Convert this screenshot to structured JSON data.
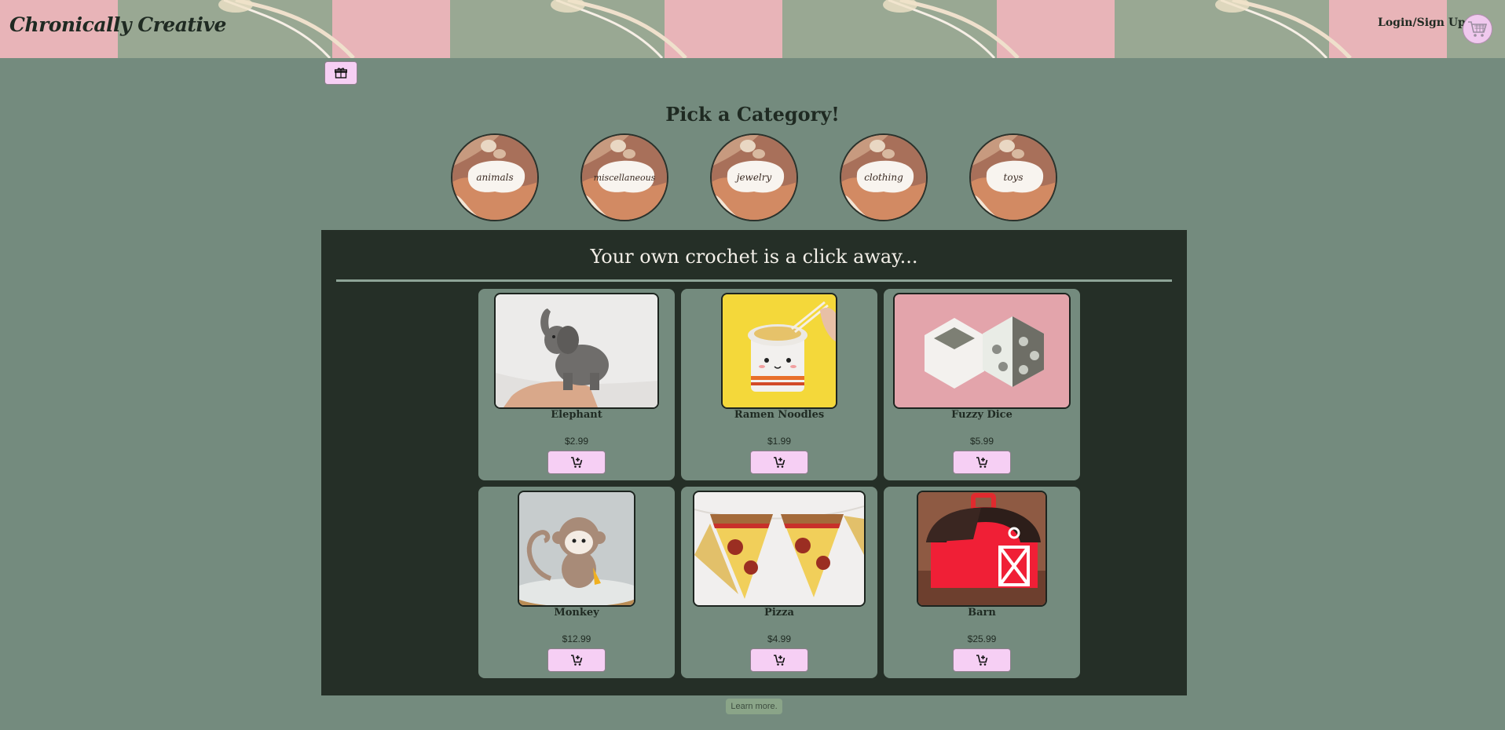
{
  "header": {
    "brand": "Chronically Creative",
    "login_label": "Login/Sign Up",
    "cart_icon": "shopping-cart-icon"
  },
  "toolbar": {
    "gift_icon": "gift-box-icon"
  },
  "categories": {
    "title": "Pick a Category!",
    "items": [
      {
        "label": "animals"
      },
      {
        "label": "miscellaneous"
      },
      {
        "label": "jewelry"
      },
      {
        "label": "clothing"
      },
      {
        "label": "toys"
      }
    ]
  },
  "products": {
    "title": "Your own crochet is a click away...",
    "items": [
      {
        "name": "Elephant",
        "price": "$2.99"
      },
      {
        "name": "Ramen Noodles",
        "price": "$1.99"
      },
      {
        "name": "Fuzzy Dice",
        "price": "$5.99"
      },
      {
        "name": "Monkey",
        "price": "$12.99"
      },
      {
        "name": "Pizza",
        "price": "$4.99"
      },
      {
        "name": "Barn",
        "price": "$25.99"
      }
    ],
    "add_icon": "add-to-cart-icon"
  },
  "footer": {
    "learn_more": "Learn more."
  },
  "colors": {
    "page_bg": "#748b7e",
    "panel_bg": "#252f27",
    "button_pink": "#f6cff4",
    "header_pink": "#e8b4b8",
    "header_sage": "#99a893"
  }
}
